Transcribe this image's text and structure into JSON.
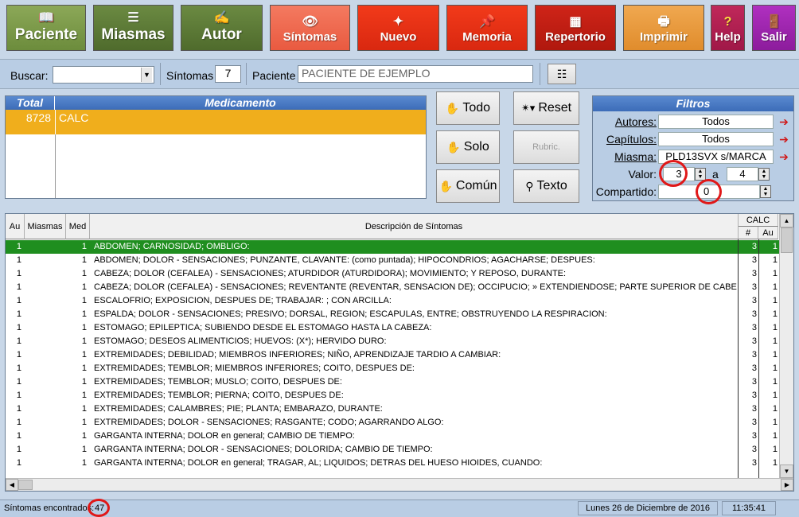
{
  "toolbar": {
    "paciente": "Paciente",
    "miasmas": "Miasmas",
    "autor": "Autor",
    "sintomas": "Síntomas",
    "nuevo": "Nuevo",
    "memoria": "Memoria",
    "repertorio": "Repertorio",
    "imprimir": "Imprimir",
    "help": "Help",
    "salir": "Salir"
  },
  "search": {
    "buscar_label": "Buscar:",
    "buscar_value": "",
    "sintomas_label": "Síntomas",
    "sintomas_count": "7",
    "paciente_label": "Paciente",
    "paciente_value": "PACIENTE DE EJEMPLO"
  },
  "medicamento": {
    "header_total": "Total",
    "header_medicamento": "Medicamento",
    "rows": [
      {
        "total": "8728",
        "name": "CALC"
      }
    ]
  },
  "buttons": {
    "todo": "Todo",
    "solo": "Solo",
    "comun": "Común",
    "reset": "Reset",
    "rubric": "Rubric.",
    "texto": "Texto"
  },
  "filtros": {
    "title": "Filtros",
    "autores_label": "Autores:",
    "autores_value": "Todos",
    "capitulos_label": "Capítulos:",
    "capitulos_value": "Todos",
    "miasma_label": "Miasma:",
    "miasma_value": "PLD13SVX s/MARCA",
    "valor_label": "Valor:",
    "valor_from": "3",
    "valor_a": "a",
    "valor_to": "4",
    "compartido_label": "Compartido:",
    "compartido_value": "0"
  },
  "table": {
    "headers": {
      "au": "Au",
      "miasmas": "Miasmas",
      "med": "Med",
      "descripcion": "Descripción de Síntomas",
      "calc": "CALC",
      "num": "#",
      "au2": "Au"
    },
    "rows": [
      {
        "au": "1",
        "med": "1",
        "desc": "ABDOMEN; CARNOSIDAD; OMBLIGO:",
        "num": "3",
        "au2": "1"
      },
      {
        "au": "1",
        "med": "1",
        "desc": "ABDOMEN; DOLOR - SENSACIONES; PUNZANTE, CLAVANTE: (como puntada); HIPOCONDRIOS; AGACHARSE; DESPUES:",
        "num": "3",
        "au2": "1"
      },
      {
        "au": "1",
        "med": "1",
        "desc": "CABEZA; DOLOR (CEFALEA) - SENSACIONES; ATURDIDOR (ATURDIDORA); MOVIMIENTO; Y REPOSO, DURANTE:",
        "num": "3",
        "au2": "1"
      },
      {
        "au": "1",
        "med": "1",
        "desc": "CABEZA; DOLOR (CEFALEA) - SENSACIONES; REVENTANTE (REVENTAR, SENSACION DE); OCCIPUCIO; » EXTENDIENDOSE; PARTE SUPERIOR DE CABEZA, es tan fue",
        "num": "3",
        "au2": "1"
      },
      {
        "au": "1",
        "med": "1",
        "desc": "ESCALOFRIO; EXPOSICION, DESPUES DE; TRABAJAR:   ; CON ARCILLA:",
        "num": "3",
        "au2": "1"
      },
      {
        "au": "1",
        "med": "1",
        "desc": "ESPALDA; DOLOR - SENSACIONES; PRESIVO; DORSAL, REGION; ESCAPULAS, ENTRE; OBSTRUYENDO LA RESPIRACION:",
        "num": "3",
        "au2": "1"
      },
      {
        "au": "1",
        "med": "1",
        "desc": "ESTOMAGO; EPILEPTICA; SUBIENDO DESDE EL ESTOMAGO HASTA LA CABEZA:",
        "num": "3",
        "au2": "1"
      },
      {
        "au": "1",
        "med": "1",
        "desc": "ESTOMAGO; DESEOS ALIMENTICIOS; HUEVOS:    (X*); HERVIDO DURO:",
        "num": "3",
        "au2": "1"
      },
      {
        "au": "1",
        "med": "1",
        "desc": "EXTREMIDADES; DEBILIDAD; MIEMBROS INFERIORES; NIÑO, APRENDIZAJE TARDIO A CAMBIAR:",
        "num": "3",
        "au2": "1"
      },
      {
        "au": "1",
        "med": "1",
        "desc": "EXTREMIDADES; TEMBLOR; MIEMBROS INFERIORES; COITO, DESPUES DE:",
        "num": "3",
        "au2": "1"
      },
      {
        "au": "1",
        "med": "1",
        "desc": "EXTREMIDADES; TEMBLOR; MUSLO; COITO, DESPUES DE:",
        "num": "3",
        "au2": "1"
      },
      {
        "au": "1",
        "med": "1",
        "desc": "EXTREMIDADES; TEMBLOR; PIERNA; COITO, DESPUES DE:",
        "num": "3",
        "au2": "1"
      },
      {
        "au": "1",
        "med": "1",
        "desc": "EXTREMIDADES; CALAMBRES; PIE; PLANTA; EMBARAZO, DURANTE:",
        "num": "3",
        "au2": "1"
      },
      {
        "au": "1",
        "med": "1",
        "desc": "EXTREMIDADES; DOLOR - SENSACIONES; RASGANTE; CODO; AGARRANDO ALGO:",
        "num": "3",
        "au2": "1"
      },
      {
        "au": "1",
        "med": "1",
        "desc": "GARGANTA INTERNA; DOLOR en general; CAMBIO DE TIEMPO:",
        "num": "3",
        "au2": "1"
      },
      {
        "au": "1",
        "med": "1",
        "desc": "GARGANTA INTERNA; DOLOR - SENSACIONES; DOLORIDA; CAMBIO DE TIEMPO:",
        "num": "3",
        "au2": "1"
      },
      {
        "au": "1",
        "med": "1",
        "desc": "GARGANTA INTERNA; DOLOR en general; TRAGAR, AL; LIQUIDOS; DETRAS DEL HUESO HIOIDES, CUANDO:",
        "num": "3",
        "au2": "1"
      }
    ]
  },
  "status": {
    "label": "Síntomas encontrados:",
    "count": "47",
    "date": "Lunes 26 de Diciembre de 2016",
    "time": "11:35:41"
  }
}
